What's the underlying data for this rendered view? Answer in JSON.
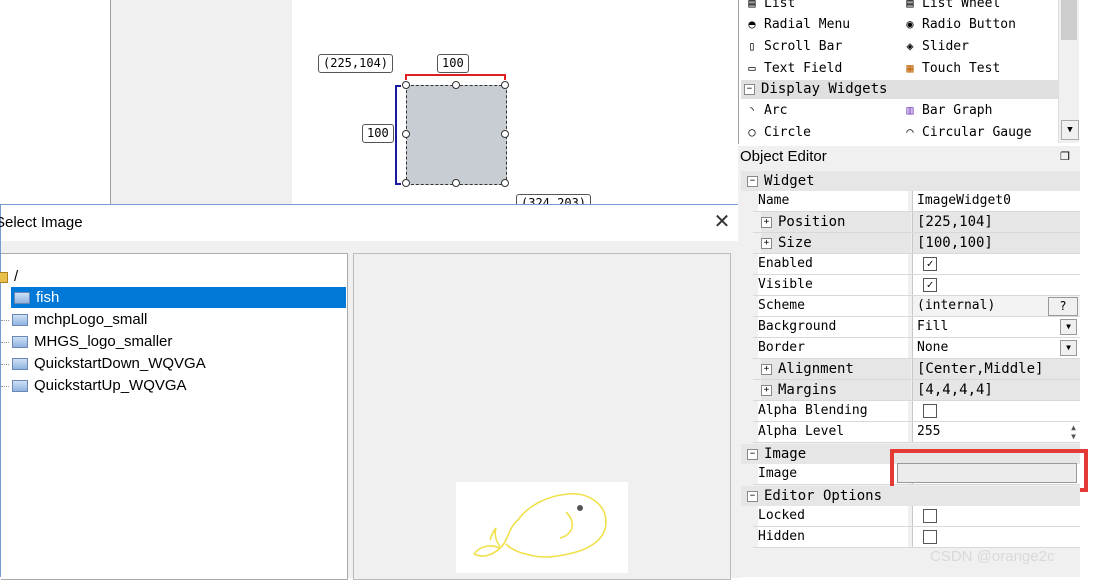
{
  "canvas": {
    "position_label": "(225,104)",
    "width_label": "100",
    "height_label": "100",
    "corner_label": "(324,203)"
  },
  "dialog": {
    "title": "Select Image",
    "close_glyph": "✕",
    "root": "/",
    "items": [
      {
        "label": "fish",
        "selected": true
      },
      {
        "label": "mchpLogo_small",
        "selected": false
      },
      {
        "label": "MHGS_logo_smaller",
        "selected": false
      },
      {
        "label": "QuickstartDown_WQVGA",
        "selected": false
      },
      {
        "label": "QuickstartUp_WQVGA",
        "selected": false
      }
    ]
  },
  "palette": {
    "rows": [
      {
        "left": {
          "icon": "list-icon",
          "label": "List"
        },
        "right": {
          "icon": "list-wheel-icon",
          "label": "List Wheel"
        }
      },
      {
        "left": {
          "icon": "radial-menu-icon",
          "label": "Radial Menu"
        },
        "right": {
          "icon": "radio-button-icon",
          "label": "Radio Button"
        }
      },
      {
        "left": {
          "icon": "scroll-bar-icon",
          "label": "Scroll Bar"
        },
        "right": {
          "icon": "slider-icon",
          "label": "Slider"
        }
      },
      {
        "left": {
          "icon": "text-field-icon",
          "label": "Text Field"
        },
        "right": {
          "icon": "touch-test-icon",
          "label": "Touch Test"
        }
      }
    ],
    "group": "Display Widgets",
    "rows2": [
      {
        "left": {
          "icon": "arc-icon",
          "label": "Arc"
        },
        "right": {
          "icon": "bar-graph-icon",
          "label": "Bar Graph"
        }
      },
      {
        "left": {
          "icon": "circle-icon",
          "label": "Circle"
        },
        "right": {
          "icon": "circular-gauge-icon",
          "label": "Circular Gauge"
        }
      }
    ]
  },
  "object_editor": {
    "title": "Object Editor",
    "widget_cat": "Widget",
    "name_label": "Name",
    "name_value": "ImageWidget0",
    "position_label": "Position",
    "position_value": "[225,104]",
    "size_label": "Size",
    "size_value": "[100,100]",
    "enabled_label": "Enabled",
    "enabled_checked": true,
    "visible_label": "Visible",
    "visible_checked": true,
    "scheme_label": "Scheme",
    "scheme_value": "(internal)",
    "scheme_btn": "?",
    "background_label": "Background",
    "background_value": "Fill",
    "border_label": "Border",
    "border_value": "None",
    "alignment_label": "Alignment",
    "alignment_value": "[Center,Middle]",
    "margins_label": "Margins",
    "margins_value": "[4,4,4,4]",
    "alpha_blending_label": "Alpha Blending",
    "alpha_level_label": "Alpha Level",
    "alpha_level_value": "255",
    "image_cat": "Image",
    "image_label": "Image",
    "editor_cat": "Editor Options",
    "locked_label": "Locked",
    "hidden_label": "Hidden"
  },
  "watermark": "CSDN @orange2c",
  "colors": {
    "selection": "#0078d7",
    "highlight": "#e53935",
    "fish_stroke": "#f0e04a"
  }
}
